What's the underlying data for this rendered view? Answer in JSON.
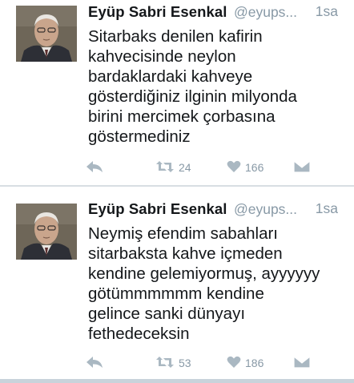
{
  "tweets": [
    {
      "author": {
        "name": "Eyüp Sabri Esenkal",
        "handle": "@eyups..."
      },
      "time": "1sa",
      "text": "Sitarbaks denilen kafirin\nkahvecisinde neylon\nbardaklardaki kahveye\ngösterdiğiniz ilginin milyonda\nbirini mercimek çorbasına\ngöstermediniz",
      "retweets": "24",
      "likes": "166"
    },
    {
      "author": {
        "name": "Eyüp Sabri Esenkal",
        "handle": "@eyups..."
      },
      "time": "1sa",
      "text": "Neymiş efendim sabahları\nsitarbaksta kahve içmeden\nkendine gelemiyormuş, ayyyyyy\ngötümmmmmm kendine\ngelince sanki dünyayı\nfethedeceksin",
      "retweets": "53",
      "likes": "186"
    }
  ],
  "icons": {
    "reply": "reply-icon",
    "retweet": "retweet-icon",
    "like": "heart-icon",
    "dm": "envelope-icon"
  },
  "colors": {
    "name": "#14171a",
    "muted": "#8899a6",
    "icon": "#aab8c2",
    "divider": "#d8dee3"
  }
}
